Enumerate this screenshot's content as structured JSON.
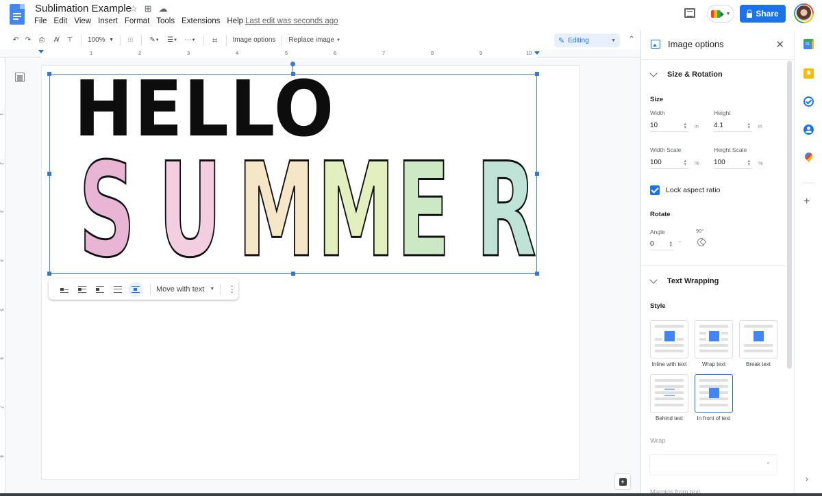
{
  "app": {
    "doc_title": "Sublimation Example",
    "title_icons": [
      "star-icon",
      "move-to-folder-icon",
      "cloud-saved-icon"
    ],
    "menu": [
      "File",
      "Edit",
      "View",
      "Insert",
      "Format",
      "Tools",
      "Extensions",
      "Help"
    ],
    "last_edit": "Last edit was seconds ago",
    "share_label": "Share"
  },
  "toolbar": {
    "zoom": "100%",
    "image_options": "Image options",
    "replace_image": "Replace image",
    "mode": "Editing"
  },
  "ruler": {
    "h_numbers": [
      "1",
      "2",
      "3",
      "4",
      "5",
      "6",
      "7",
      "8",
      "9",
      "10"
    ],
    "v_numbers": [
      "1",
      "2",
      "3",
      "4",
      "5",
      "6",
      "7",
      "8"
    ]
  },
  "document": {
    "image_text_line1": "HELLO",
    "image_text_line2": [
      "S",
      "U",
      "M",
      "M",
      "E",
      "R"
    ],
    "image_letter_colors": [
      "#e9b5d4",
      "#f3cde0",
      "#f6e6c8",
      "#e4efbe",
      "#cde8c4",
      "#bfe3d6"
    ]
  },
  "image_toolbar": {
    "wrap_options": [
      "Inline",
      "Wrap text",
      "Break text",
      "Behind text",
      "In front of text"
    ],
    "active_wrap": "In front of text",
    "position_mode": "Move with text"
  },
  "panel": {
    "title": "Image options",
    "size_rotation": {
      "heading": "Size & Rotation",
      "size_label": "Size",
      "width_label": "Width",
      "width_value": "10",
      "width_unit": "in",
      "height_label": "Height",
      "height_value": "4.1",
      "height_unit": "in",
      "width_scale_label": "Width Scale",
      "width_scale_value": "100",
      "height_scale_label": "Height Scale",
      "height_scale_value": "100",
      "scale_unit": "%",
      "lock_aspect_label": "Lock aspect ratio",
      "lock_aspect_checked": true,
      "rotate_label": "Rotate",
      "angle_label": "Angle",
      "angle_value": "0",
      "angle_unit": "°",
      "rotate90_label": "90°"
    },
    "text_wrapping": {
      "heading": "Text Wrapping",
      "style_label": "Style",
      "options": [
        {
          "label": "Inline with text",
          "selected": false
        },
        {
          "label": "Wrap text",
          "selected": false
        },
        {
          "label": "Break text",
          "selected": false
        },
        {
          "label": "Behind text",
          "selected": false
        },
        {
          "label": "In front of text",
          "selected": true
        }
      ],
      "wrap_label": "Wrap",
      "wrap_value": "",
      "margins_label": "Margins from text"
    }
  },
  "rail": {
    "icons": [
      "calendar-icon",
      "keep-icon",
      "tasks-icon",
      "contacts-icon",
      "maps-icon"
    ],
    "calendar_day": "31"
  },
  "colors": {
    "accent": "#1a73e8",
    "selection": "#3b78c9"
  }
}
